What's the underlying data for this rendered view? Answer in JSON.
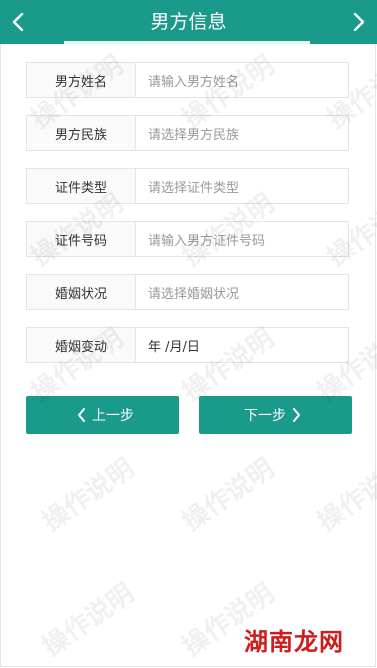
{
  "header": {
    "title": "男方信息",
    "back_icon": "chevron-left-icon",
    "next_icon": "chevron-right-icon"
  },
  "form": {
    "rows": [
      {
        "label": "男方姓名",
        "placeholder": "请输入男方姓名"
      },
      {
        "label": "男方民族",
        "placeholder": "请选择男方民族"
      },
      {
        "label": "证件类型",
        "placeholder": "请选择证件类型"
      },
      {
        "label": "证件号码",
        "placeholder": "请输入男方证件号码"
      },
      {
        "label": "婚姻状况",
        "placeholder": "请选择婚姻状况"
      },
      {
        "label": "婚姻变动",
        "value": "年 /月/日"
      }
    ]
  },
  "buttons": {
    "prev": "上一步",
    "next": "下一步"
  },
  "watermark": "操作说明",
  "site_logo": "湖南龙网",
  "colors": {
    "accent": "#1a9a8a",
    "logo": "#cf1c1c"
  }
}
